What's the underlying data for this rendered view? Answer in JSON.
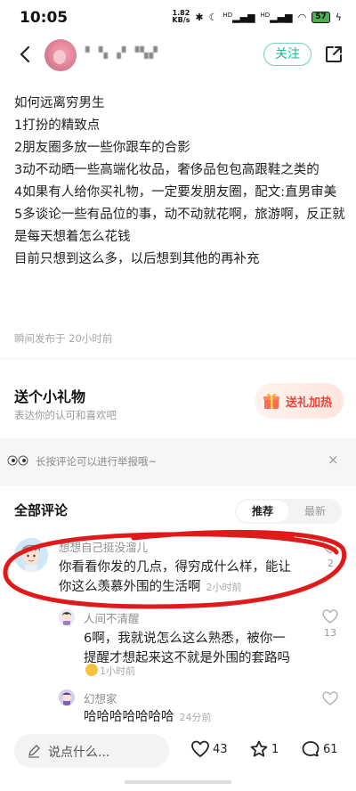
{
  "status_bar": {
    "time": "10:05",
    "net_speed_value": "1.82",
    "net_speed_unit": "KB/s",
    "signal_1": "HD",
    "signal_2": "HD",
    "battery": "57"
  },
  "header": {
    "user_name": "▘▝▖▗▘▝▚▞",
    "follow_label": "关注"
  },
  "post": {
    "lines": [
      "如何远离穷男生",
      "1打扮的精致点",
      "2朋友圈多放一些你跟车的合影",
      "3动不动晒一些高端化妆品，奢侈品包包高跟鞋之类的",
      "4如果有人给你买礼物，一定要发朋友圈，配文:直男审美",
      "5多谈论一些有品位的事，动不动就花啊，旅游啊，反正就是每天想着怎么花钱",
      "目前只想到这么多，以后想到其他的再补充"
    ],
    "time": "瞬间发布于 20小时前"
  },
  "gift": {
    "title": "送个小礼物",
    "subtitle": "表达你的认可和喜欢吧",
    "button_label": "送礼加热"
  },
  "report": {
    "text": "长按评论可以进行举报哦~",
    "close": "×"
  },
  "comments_section": {
    "title": "全部评论",
    "sort_active": "推荐",
    "sort_inactive": "最新"
  },
  "comments": [
    {
      "name": "想想自己挺没溜儿",
      "text_line1": "你看看你发的几点，得穷成什么样，能让",
      "text_line2": "你这么羡慕外围的生活啊",
      "time": "2小时前",
      "likes": "2"
    },
    {
      "name": "人间不清醒",
      "text_line1": "6啊，我就说怎么这么熟悉，被你一",
      "text_line2": "提醒才想起来这不就是外围的套路吗",
      "time": "1小时前",
      "likes": "13"
    },
    {
      "name": "幻想家",
      "text_line1": "哈哈哈哈哈哈哈",
      "time": "24分前"
    }
  ],
  "bottom_bar": {
    "input_placeholder": "说点什么...",
    "like_count": "43",
    "star_count": "1",
    "comment_count": "61"
  },
  "colors": {
    "accent_teal": "#22b59a",
    "gift_red": "#e8463a",
    "annotation_red": "#e01a1a"
  }
}
